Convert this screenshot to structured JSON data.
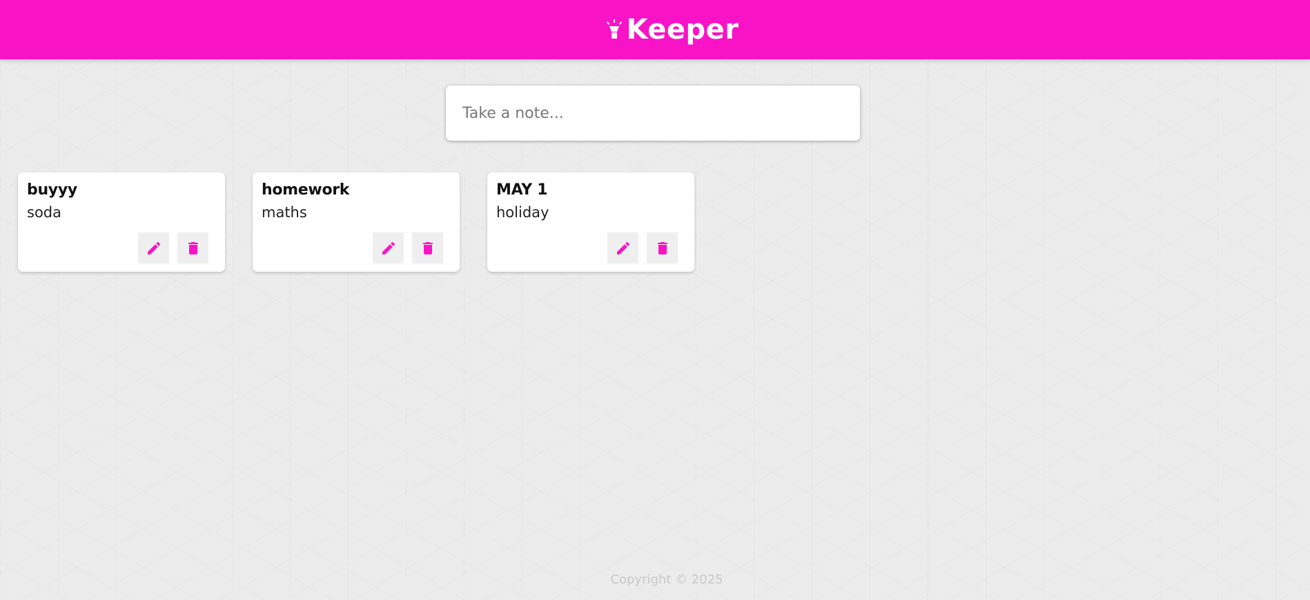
{
  "header": {
    "title": "Keeper",
    "logo_icon": "lightbulb-highlight-icon",
    "color": "#f913c7"
  },
  "create_area": {
    "placeholder": "Take a note..."
  },
  "notes": [
    {
      "title": "buyyy",
      "content": "soda"
    },
    {
      "title": "homework",
      "content": "maths"
    },
    {
      "title": "MAY 1",
      "content": "holiday"
    }
  ],
  "note_actions": {
    "edit_icon": "pencil-icon",
    "delete_icon": "trash-icon",
    "accent_color": "#f913c7"
  },
  "footer": {
    "copyright": "Copyright © 2025"
  }
}
